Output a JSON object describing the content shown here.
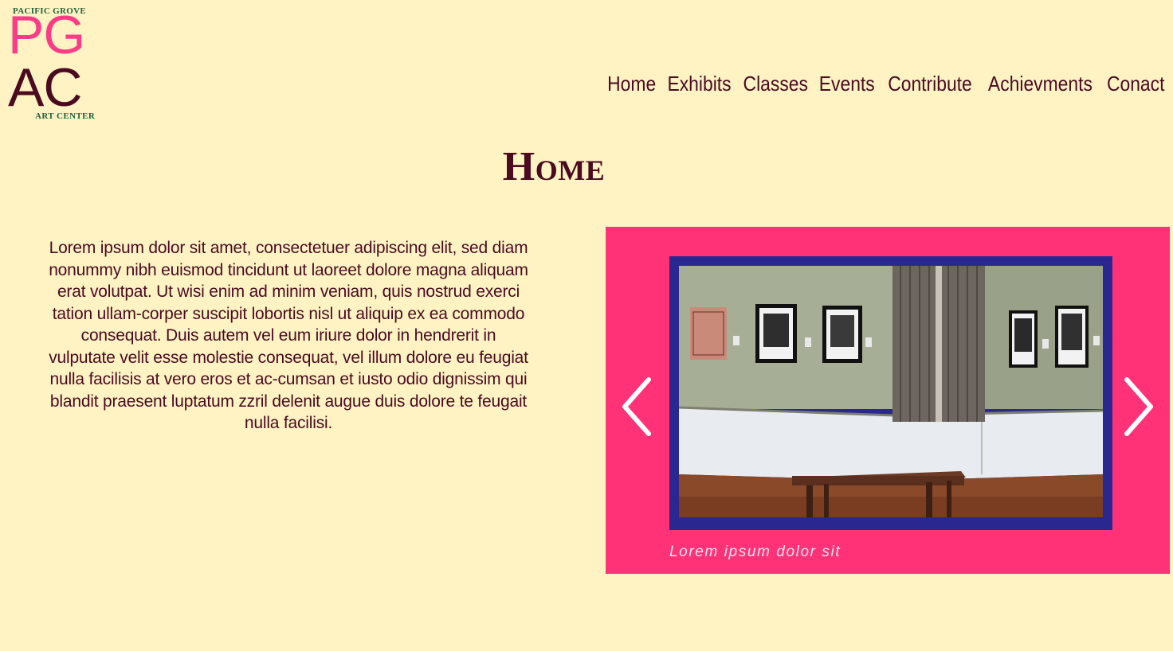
{
  "logo": {
    "top_text": "PACIFIC GROVE",
    "line1": "PG",
    "line2": "AC",
    "bottom_text": "ART CENTER"
  },
  "nav": {
    "items": [
      "Home",
      "Exhibits",
      "Classes",
      "Events",
      "Contribute",
      "Achievments",
      "Conact"
    ]
  },
  "page": {
    "title": "Home",
    "body": "Lorem ipsum dolor sit amet, consectetuer adipiscing elit, sed diam nonummy nibh euismod tincidunt ut laoreet dolore magna aliquam erat volutpat. Ut wisi enim ad minim veniam, quis nostrud exerci tation ullam-corper suscipit lobortis nisl ut aliquip ex ea commodo consequat. Duis autem vel eum iriure dolor in hendrerit in vulputate velit esse molestie consequat, vel illum dolore eu feugiat nulla facilisis at vero eros et ac-cumsan et iusto odio dignissim qui blandit praesent luptatum zzril delenit augue duis dolore te feugait nulla facilisi."
  },
  "carousel": {
    "caption": "Lorem ipsum dolor sit",
    "prev_icon": "chevron-left-icon",
    "next_icon": "chevron-right-icon"
  },
  "colors": {
    "background": "#fff3c4",
    "brand_pink": "#ff3278",
    "frame_blue": "#2a2890",
    "text_maroon": "#4a0a20",
    "logo_green": "#24603a"
  }
}
